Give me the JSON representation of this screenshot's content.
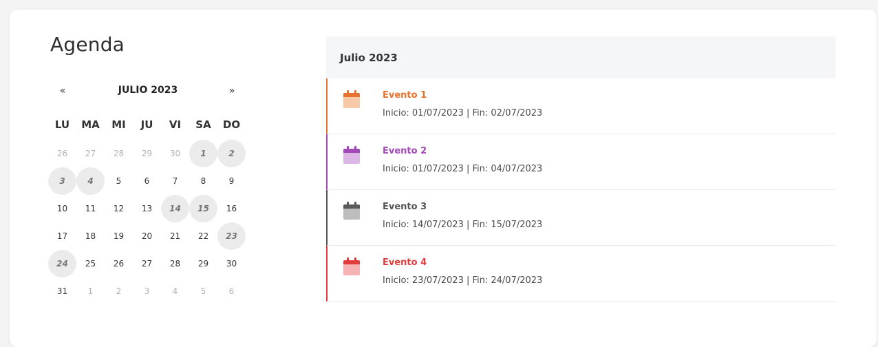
{
  "page": {
    "title": "Agenda"
  },
  "calendar": {
    "prev": "«",
    "next": "»",
    "month_label": "JULIO 2023",
    "weekdays": [
      "LU",
      "MA",
      "MI",
      "JU",
      "VI",
      "SA",
      "DO"
    ],
    "weeks": [
      [
        {
          "d": "26",
          "m": true,
          "e": false
        },
        {
          "d": "27",
          "m": true,
          "e": false
        },
        {
          "d": "28",
          "m": true,
          "e": false
        },
        {
          "d": "29",
          "m": true,
          "e": false
        },
        {
          "d": "30",
          "m": true,
          "e": false
        },
        {
          "d": "1",
          "m": false,
          "e": true
        },
        {
          "d": "2",
          "m": false,
          "e": true
        }
      ],
      [
        {
          "d": "3",
          "m": false,
          "e": true
        },
        {
          "d": "4",
          "m": false,
          "e": true
        },
        {
          "d": "5",
          "m": false,
          "e": false
        },
        {
          "d": "6",
          "m": false,
          "e": false
        },
        {
          "d": "7",
          "m": false,
          "e": false
        },
        {
          "d": "8",
          "m": false,
          "e": false
        },
        {
          "d": "9",
          "m": false,
          "e": false
        }
      ],
      [
        {
          "d": "10",
          "m": false,
          "e": false
        },
        {
          "d": "11",
          "m": false,
          "e": false
        },
        {
          "d": "12",
          "m": false,
          "e": false
        },
        {
          "d": "13",
          "m": false,
          "e": false
        },
        {
          "d": "14",
          "m": false,
          "e": true
        },
        {
          "d": "15",
          "m": false,
          "e": true
        },
        {
          "d": "16",
          "m": false,
          "e": false
        }
      ],
      [
        {
          "d": "17",
          "m": false,
          "e": false
        },
        {
          "d": "18",
          "m": false,
          "e": false
        },
        {
          "d": "19",
          "m": false,
          "e": false
        },
        {
          "d": "20",
          "m": false,
          "e": false
        },
        {
          "d": "21",
          "m": false,
          "e": false
        },
        {
          "d": "22",
          "m": false,
          "e": false
        },
        {
          "d": "23",
          "m": false,
          "e": true
        }
      ],
      [
        {
          "d": "24",
          "m": false,
          "e": true
        },
        {
          "d": "25",
          "m": false,
          "e": false
        },
        {
          "d": "26",
          "m": false,
          "e": false
        },
        {
          "d": "27",
          "m": false,
          "e": false
        },
        {
          "d": "28",
          "m": false,
          "e": false
        },
        {
          "d": "29",
          "m": false,
          "e": false
        },
        {
          "d": "30",
          "m": false,
          "e": false
        }
      ],
      [
        {
          "d": "31",
          "m": false,
          "e": false
        },
        {
          "d": "1",
          "m": true,
          "e": false
        },
        {
          "d": "2",
          "m": true,
          "e": false
        },
        {
          "d": "3",
          "m": true,
          "e": false
        },
        {
          "d": "4",
          "m": true,
          "e": false
        },
        {
          "d": "5",
          "m": true,
          "e": false
        },
        {
          "d": "6",
          "m": true,
          "e": false
        }
      ]
    ]
  },
  "events_panel": {
    "header": "Julio 2023",
    "events": [
      {
        "name": "Evento 1",
        "dates": "Inicio: 01/07/2023 | Fin: 02/07/2023",
        "color": "#e8712d",
        "icon": "calendar-icon",
        "icon_top": "#e8712d",
        "icon_body": "#f7c9a6"
      },
      {
        "name": "Evento 2",
        "dates": "Inicio: 01/07/2023 | Fin: 04/07/2023",
        "color": "#a348b8",
        "icon": "calendar-icon",
        "icon_top": "#a348b8",
        "icon_body": "#dcb6e6"
      },
      {
        "name": "Evento 3",
        "dates": "Inicio: 14/07/2023 | Fin: 15/07/2023",
        "color": "#555555",
        "icon": "calendar-icon",
        "icon_top": "#5a5a5a",
        "icon_body": "#bdbdbd"
      },
      {
        "name": "Evento 4",
        "dates": "Inicio: 23/07/2023 | Fin: 24/07/2023",
        "color": "#e23b3b",
        "icon": "calendar-icon",
        "icon_top": "#e23b3b",
        "icon_body": "#f7b3b3"
      }
    ]
  }
}
